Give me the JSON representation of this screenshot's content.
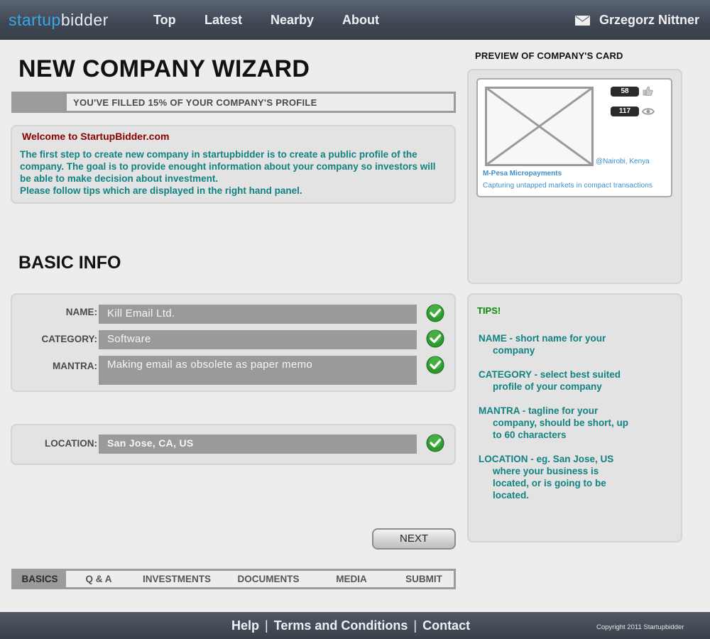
{
  "header": {
    "logo_part1": "startup",
    "logo_part2": "bidder",
    "nav": [
      "Top",
      "Latest",
      "Nearby",
      "About"
    ],
    "username": "Grzegorz Nittner"
  },
  "title": "NEW COMPANY WIZARD",
  "progress": {
    "text": "YOU'VE FILLED 15% OF YOUR COMPANY'S PROFILE",
    "percent": 15
  },
  "welcome": {
    "title": "Welcome to StartupBidder.com",
    "line1": "The first step to create new company in startupbidder is to create a public profile of the company. The goal is to provide enought information about your company so investors will be able to make decision about investment.",
    "line2": "Please follow tips which are displayed in the right hand panel."
  },
  "basic_info": {
    "title": "BASIC INFO",
    "name_label": "NAME:",
    "name_value": "Kill Email Ltd.",
    "category_label": "CATEGORY:",
    "category_value": "Software",
    "mantra_label": "MANTRA:",
    "mantra_value": "Making email as obsolete as paper memo",
    "location_label": "LOCATION:",
    "location_value": "San Jose, CA, US"
  },
  "next_label": "NEXT",
  "tabs": [
    "BASICS",
    "Q & A",
    "INVESTMENTS",
    "DOCUMENTS",
    "MEDIA",
    "SUBMIT"
  ],
  "active_tab": "BASICS",
  "preview": {
    "title": "PREVIEW OF COMPANY'S CARD",
    "likes": "58",
    "views": "117",
    "location": "@Nairobi, Kenya",
    "company": "M-Pesa Micropayments",
    "tagline": "Capturing untapped markets in compact transactions"
  },
  "tips": {
    "title": "TIPS!",
    "name_tip_1": "NAME - short name for your",
    "name_tip_2": "company",
    "category_tip_1": "CATEGORY - select best suited",
    "category_tip_2": "profile of your company",
    "mantra_tip_1": "MANTRA - tagline for your",
    "mantra_tip_2": "company, should be short, up",
    "mantra_tip_3": "to 60 characters",
    "location_tip_1": "LOCATION - eg. San Jose, US",
    "location_tip_2": "where your business is",
    "location_tip_3": "located, or is going to be",
    "location_tip_4": "located."
  },
  "footer": {
    "help": "Help",
    "terms": "Terms and Conditions",
    "contact": "Contact",
    "separator": "|",
    "copyright": "Copyright 2011 Startupbidder"
  },
  "colors": {
    "logo_blue": "#38a8e8",
    "header_bg": "#3f4754",
    "teal_text": "#128282",
    "welcome_red": "#8a0000",
    "tips_green": "#0a8a0a",
    "input_gray": "#9a9a9a",
    "check_green": "#2e9a2e"
  },
  "icons": [
    "mail-icon",
    "check-icon",
    "thumbs-up-icon",
    "eye-icon",
    "image-placeholder-icon"
  ]
}
